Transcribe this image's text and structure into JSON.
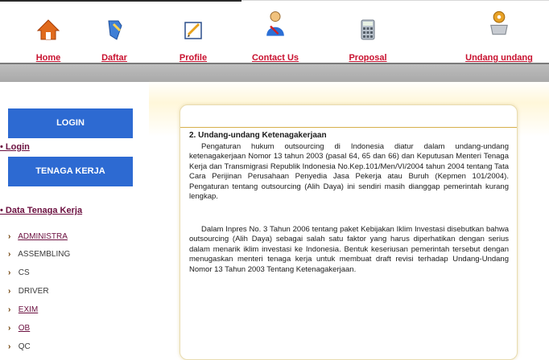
{
  "nav": {
    "items": [
      {
        "label": "Home",
        "icon": "home-icon"
      },
      {
        "label": "Daftar",
        "icon": "register-icon"
      },
      {
        "label": "Profile",
        "icon": "profile-icon"
      },
      {
        "label": "Contact Us",
        "icon": "contact-icon"
      },
      {
        "label": "Proposal",
        "icon": "calculator-icon"
      },
      {
        "label": "Undang undang",
        "icon": "law-gear-icon"
      }
    ],
    "label_color": "#c8102e"
  },
  "sidebar": {
    "login_block": "LOGIN",
    "login_link": "• Login",
    "tenaga_block": "TENAGA KERJA",
    "data_link": "• Data Tenaga Kerja",
    "items": [
      {
        "label": "ADMINISTRA",
        "linked": true
      },
      {
        "label": "ASSEMBLING",
        "linked": false
      },
      {
        "label": "CS",
        "linked": false
      },
      {
        "label": "DRIVER",
        "linked": false
      },
      {
        "label": "EXIM",
        "linked": true
      },
      {
        "label": "OB",
        "linked": true
      },
      {
        "label": "QC",
        "linked": false
      }
    ],
    "block_color": "#2d6ad2"
  },
  "content": {
    "heading": "2. Undang-undang Ketenagakerjaan",
    "para1": "Pengaturan hukum outsourcing di Indonesia diatur dalam undang-undang ketenagakerjaan Nomor 13 tahun 2003 (pasal 64, 65 dan 66) dan Keputusan Menteri Tenaga Kerja dan Transmigrasi Republik Indonesia No.Kep.101/Men/VI/2004 tahun 2004 tentang Tata Cara Perijinan Perusahaan Penyedia Jasa Pekerja atau Buruh (Kepmen 101/2004). Pengaturan tentang outsourcing (Alih Daya) ini sendiri masih dianggap pemerintah kurang lengkap.",
    "para2": "Dalam Inpres No. 3 Tahun 2006 tentang paket Kebijakan Iklim Investasi disebutkan bahwa outsourcing (Alih Daya) sebagai salah satu faktor yang harus diperhatikan dengan serius dalam menarik iklim investasi ke Indonesia. Bentuk keseriusan pemerintah tersebut dengan menugaskan menteri tenaga kerja untuk membuat draft revisi terhadap Undang-Undang Nomor 13 Tahun 2003 Tentang Ketenagakerjaan."
  }
}
